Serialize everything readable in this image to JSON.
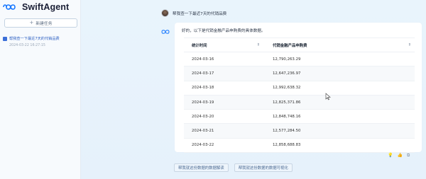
{
  "app": {
    "name": "SwiftAgent",
    "brand_color": "#1677ff"
  },
  "sidebar": {
    "new_task_label": "新建任务",
    "history": [
      {
        "title": "帮我查一下最近7天的代销品费",
        "time": "2024-03-22 16:27:15"
      }
    ]
  },
  "chat": {
    "user_message": "帮我查一下最近7天的代销品费",
    "bot_reply": "好的，以下是代销金融产品申购费的具体数据。",
    "table": {
      "headers": [
        "统计时间",
        "代销金融产品申购费"
      ],
      "rows": [
        [
          "2024-03-16",
          "12,790,263.29"
        ],
        [
          "2024-03-17",
          "12,647,236.97"
        ],
        [
          "2024-03-18",
          "12,992,638.32"
        ],
        [
          "2024-03-19",
          "12,825,371.86"
        ],
        [
          "2024-03-20",
          "12,848,748.16"
        ],
        [
          "2024-03-21",
          "12,577,284.50"
        ],
        [
          "2024-03-22",
          "12,858,688.83"
        ]
      ]
    },
    "action_icons": [
      "bulb-icon",
      "thumbs-up-icon",
      "copy-icon"
    ]
  },
  "suggestions": [
    "帮我就这份数据的数据解读",
    "帮我就这份数据的数据可视化"
  ]
}
